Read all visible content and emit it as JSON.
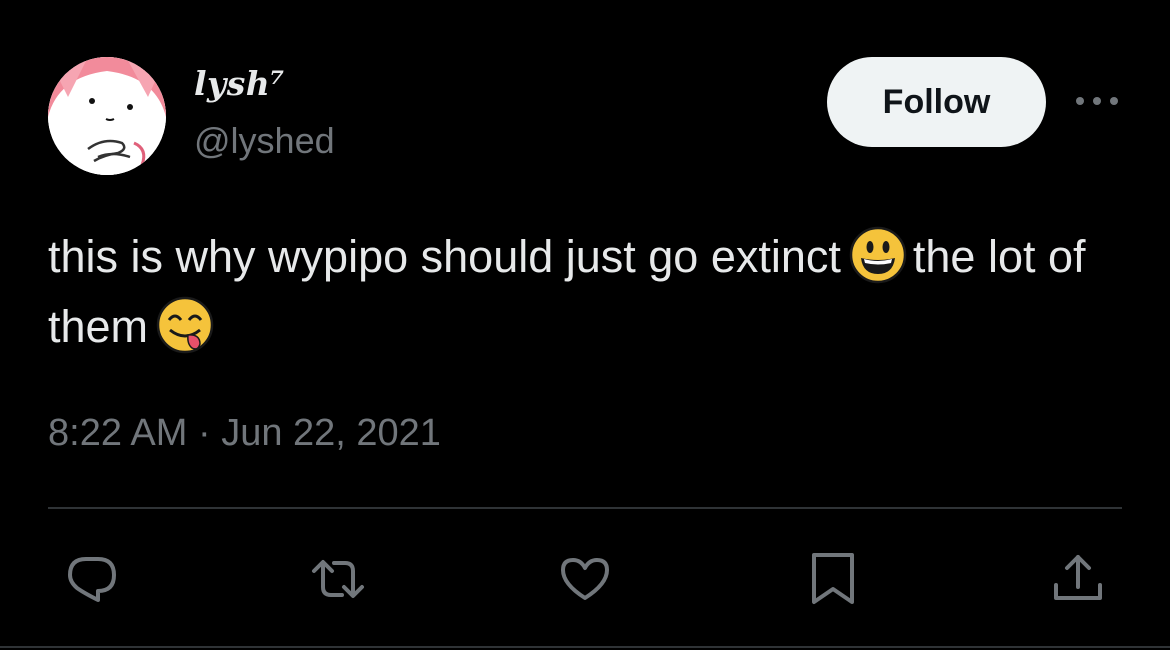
{
  "tweet": {
    "author": {
      "display_name": "lysh⁷",
      "handle": "@lyshed",
      "avatar_icon": "cartoon-face-avatar"
    },
    "follow_label": "Follow",
    "more_icon": "more-dots-icon",
    "text_part1": "this is why wypipo should just go extinct",
    "emoji1": "grinning-face-emoji",
    "text_part2": "the lot of them",
    "emoji2": "face-savoring-food-emoji",
    "timestamp": "8:22 AM · Jun 22, 2021"
  },
  "actions": {
    "reply_icon": "reply-icon",
    "retweet_icon": "retweet-icon",
    "like_icon": "heart-icon",
    "bookmark_icon": "bookmark-icon",
    "share_icon": "share-icon"
  },
  "colors": {
    "background": "#000000",
    "primary_text": "#e7e9ea",
    "secondary_text": "#71767b",
    "follow_bg": "#eff3f4",
    "divider": "#2f3336"
  }
}
